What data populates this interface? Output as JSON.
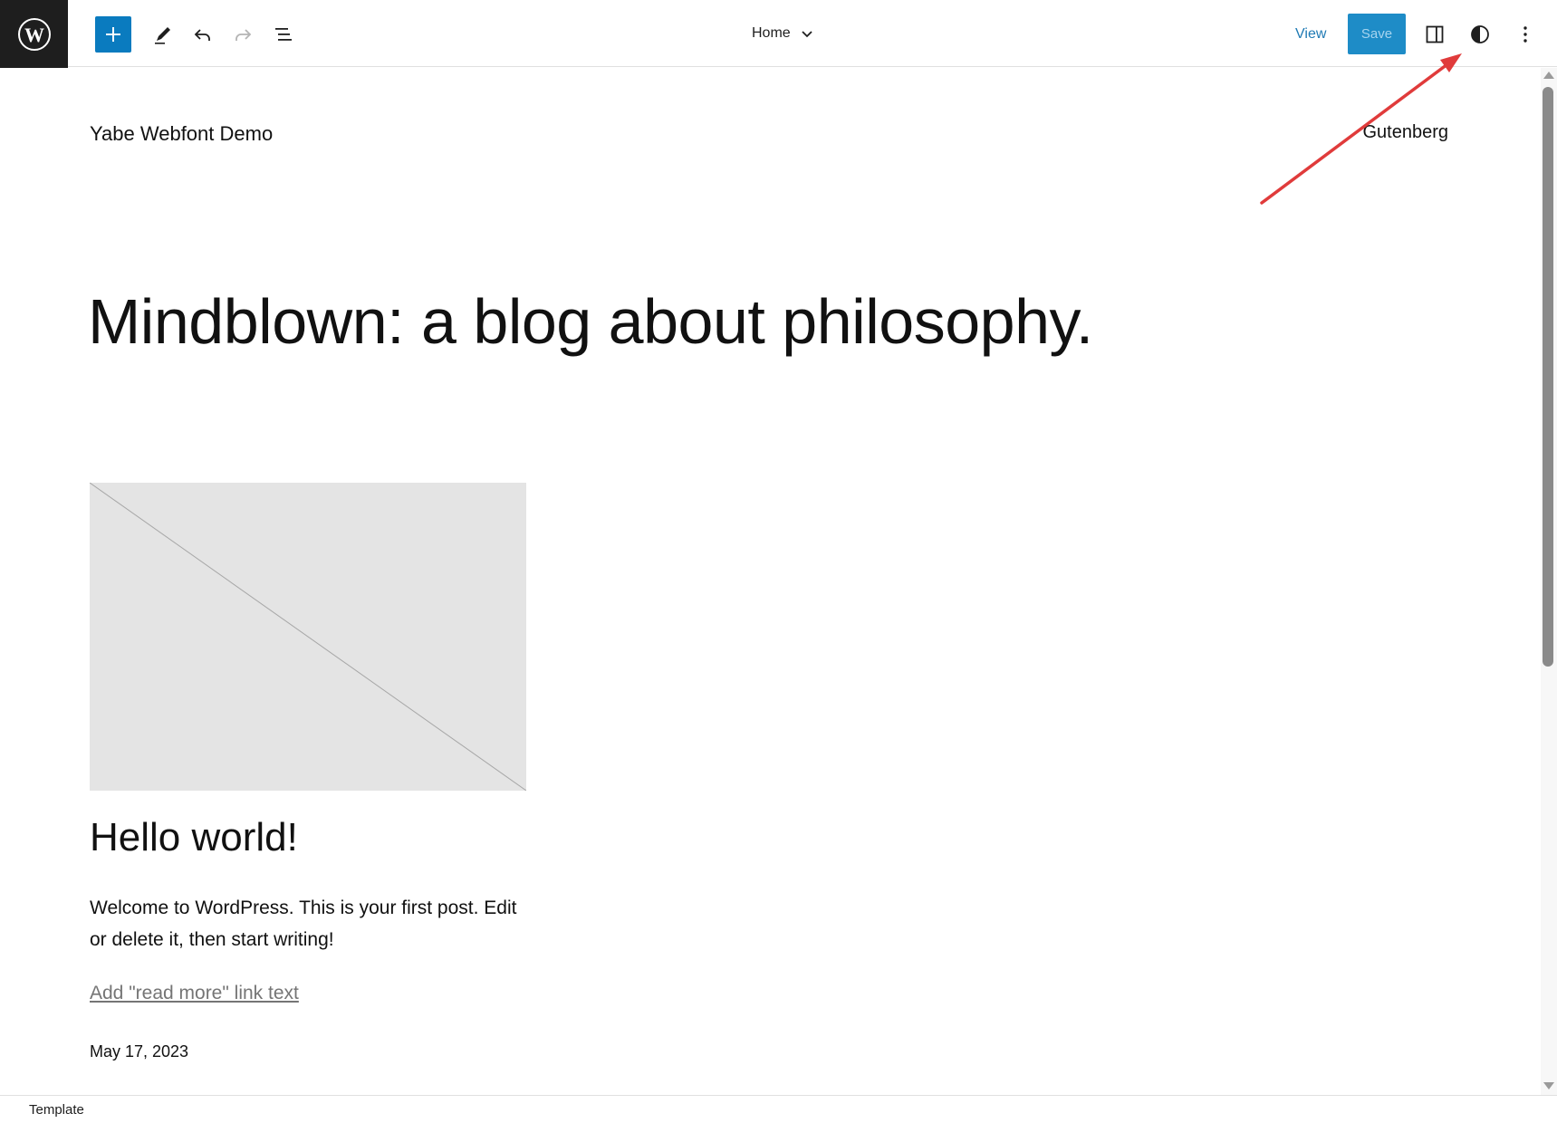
{
  "topbar": {
    "document_title": "Home",
    "view_label": "View",
    "save_label": "Save"
  },
  "canvas": {
    "site_title": "Yabe Webfont Demo",
    "nav_link": "Gutenberg",
    "hero_heading": "Mindblown: a blog about philosophy.",
    "post": {
      "title": "Hello world!",
      "excerpt": "Welcome to WordPress. This is your first post. Edit or delete it, then start writing!",
      "read_more": "Add \"read more\" link text",
      "date": "May 17, 2023"
    }
  },
  "footer": {
    "breadcrumb": "Template"
  },
  "colors": {
    "accent": "#0a7bbf",
    "annotation_arrow": "#e03b3b"
  }
}
